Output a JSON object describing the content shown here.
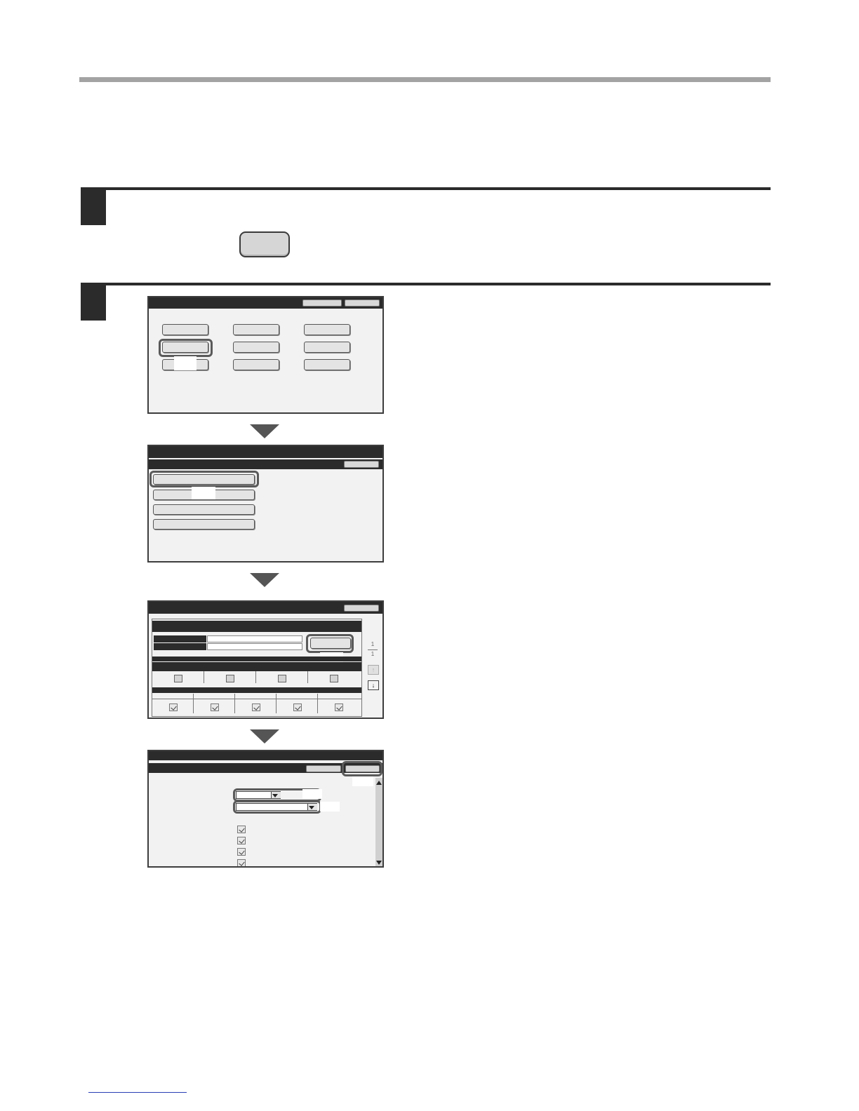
{
  "page": {
    "background": "#ffffff",
    "rule_color": "#a3a3a3",
    "accent_dark": "#2b2b2b"
  },
  "steps": [
    {
      "id": "step-1",
      "number": "",
      "text": ""
    },
    {
      "id": "step-2",
      "number": "",
      "text": ""
    }
  ],
  "key_button": {
    "label": "",
    "icon": "operation-key-icon"
  },
  "screens": {
    "screen1": {
      "title": "",
      "grid_rows": 3,
      "grid_cols": 3
    },
    "screen2": {
      "title": "",
      "list_items": 4
    },
    "screen3": {
      "title": "",
      "page_indicator_top": "1",
      "page_indicator_bottom": "1"
    },
    "screen4": {
      "title": "",
      "checkbox_rows": 4
    }
  },
  "icons": {
    "arrow_down": "down-arrow-icon",
    "scroll_up": "scroll-up-icon",
    "scroll_down": "scroll-down-icon",
    "checkmark": "checkmark-icon"
  }
}
